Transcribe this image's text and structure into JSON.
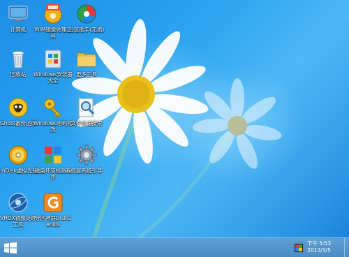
{
  "desktop": {
    "icons": [
      {
        "label": "计算机",
        "icon": "computer-icon"
      },
      {
        "label": "WIM镜像处理工具",
        "icon": "wim-tool-icon"
      },
      {
        "label": "分区助手(无损)",
        "icon": "partition-assistant-icon"
      },
      {
        "label": "回收站",
        "icon": "recycle-bin-icon"
      },
      {
        "label": "Windows安装器大全",
        "icon": "windows-installer-icon"
      },
      {
        "label": "更多工具",
        "icon": "folder-icon"
      },
      {
        "label": "Ghost备份还原",
        "icon": "ghost-icon"
      },
      {
        "label": "Windows密码修改",
        "icon": "key-icon"
      },
      {
        "label": "文件快速搜索",
        "icon": "file-search-icon"
      },
      {
        "label": "imDisk虚拟光驱",
        "icon": "imdisk-icon"
      },
      {
        "label": "磁盘坏道检测程序",
        "icon": "disk-check-icon"
      },
      {
        "label": "修复系统引导",
        "icon": "gear-icon"
      },
      {
        "label": "VHDX镜像处理工具",
        "icon": "vhdx-icon"
      },
      {
        "label": "分区神器DiskGenius",
        "icon": "diskgenius-icon"
      }
    ]
  },
  "taskbar": {
    "start_icon": "windows-logo-icon",
    "tray_icon": "network-icon",
    "clock_time": "下午 5:53",
    "clock_date": "2013/3/5"
  },
  "colors": {
    "taskbar": "#4a8cc6",
    "wallpaper": "#2aa3f0"
  }
}
